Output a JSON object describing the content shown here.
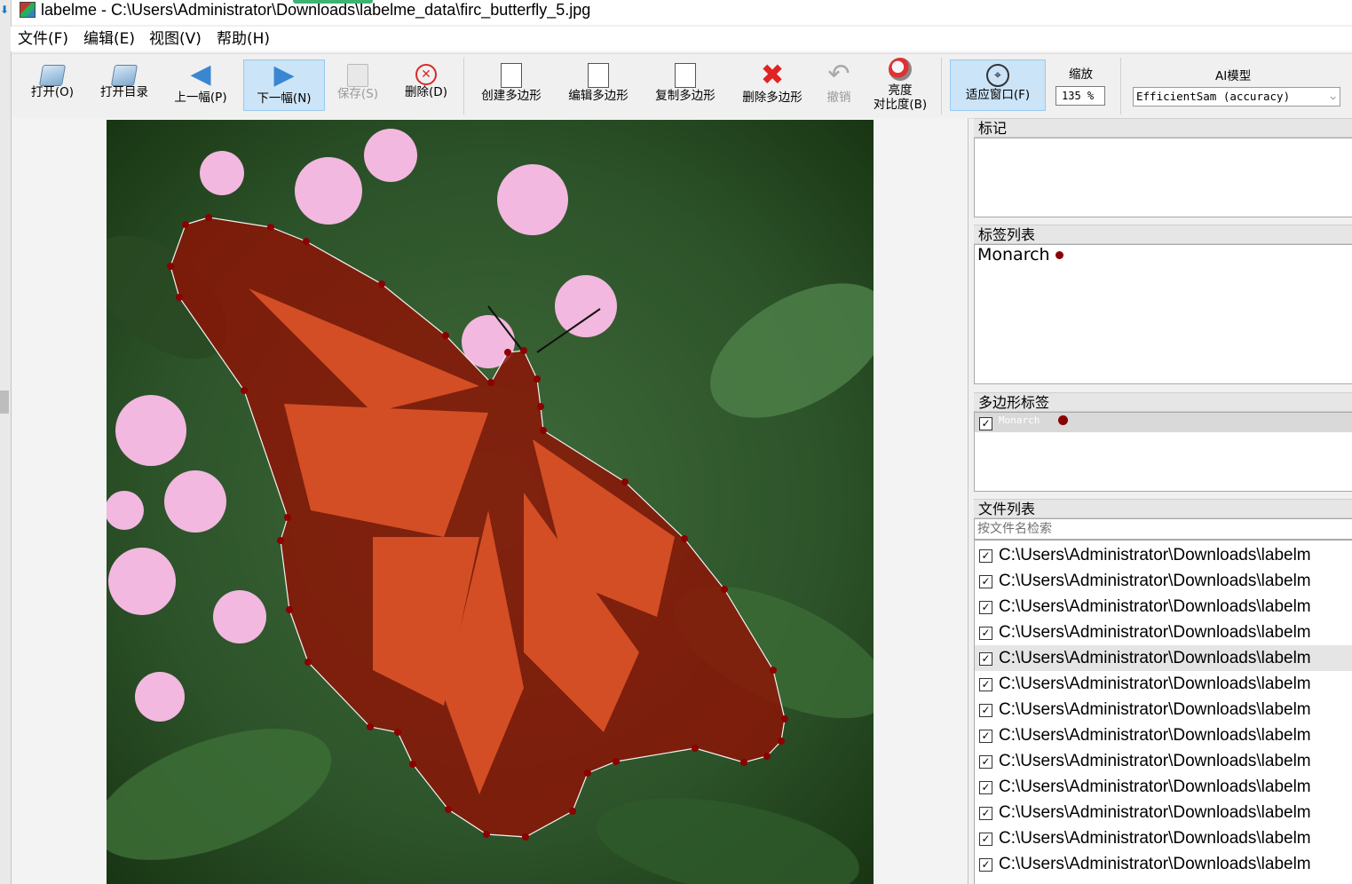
{
  "window": {
    "title": "labelme - C:\\Users\\Administrator\\Downloads\\labelme_data\\firc_butterfly_5.jpg"
  },
  "menu": [
    "文件(F)",
    "编辑(E)",
    "视图(V)",
    "帮助(H)"
  ],
  "toolbar": {
    "open": "打开(O)",
    "open_dir": "打开目录",
    "prev": "上一幅(P)",
    "next": "下一幅(N)",
    "save": "保存(S)",
    "delete": "删除(D)",
    "create_polygon": "创建多边形",
    "edit_polygon": "编辑多边形",
    "copy_polygon": "复制多边形",
    "delete_polygon": "删除多边形",
    "undo": "撤销",
    "brightness_1": "亮度",
    "brightness_2": "对比度(B)",
    "fit_window": "适应窗口(F)",
    "zoom_label": "缩放",
    "zoom_value": "135 %",
    "ai_label": "AI模型",
    "ai_model": "EfficientSam (accuracy)"
  },
  "docks": {
    "flags_title": "标记",
    "labels_title": "标签列表",
    "labels": [
      {
        "name": "Monarch",
        "color": "#8b0000"
      }
    ],
    "polygons_title": "多边形标签",
    "polygons": [
      {
        "name": "Monarch",
        "checked": true,
        "color": "#8b0000"
      }
    ],
    "files_title": "文件列表",
    "file_search_placeholder": "按文件名检索"
  },
  "files": [
    "C:\\Users\\Administrator\\Downloads\\labelm",
    "C:\\Users\\Administrator\\Downloads\\labelm",
    "C:\\Users\\Administrator\\Downloads\\labelm",
    "C:\\Users\\Administrator\\Downloads\\labelm",
    "C:\\Users\\Administrator\\Downloads\\labelm",
    "C:\\Users\\Administrator\\Downloads\\labelm",
    "C:\\Users\\Administrator\\Downloads\\labelm",
    "C:\\Users\\Administrator\\Downloads\\labelm",
    "C:\\Users\\Administrator\\Downloads\\labelm",
    "C:\\Users\\Administrator\\Downloads\\labelm",
    "C:\\Users\\Administrator\\Downloads\\labelm",
    "C:\\Users\\Administrator\\Downloads\\labelm",
    "C:\\Users\\Administrator\\Downloads\\labelm"
  ],
  "selected_file_index": 4,
  "colors": {
    "polygon": "#8b0000",
    "selection": "#cce4f7"
  }
}
